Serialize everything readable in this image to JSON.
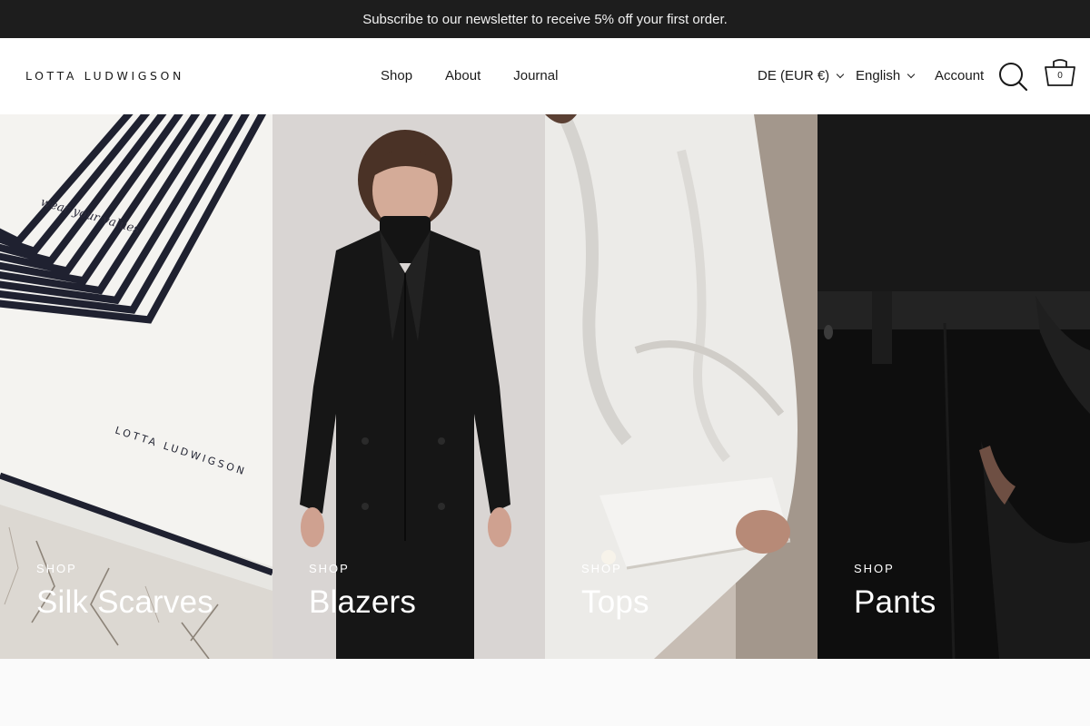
{
  "announcement": "Subscribe to our newsletter to receive 5% off your first order.",
  "brand": "LOTTA LUDWIGSON",
  "nav": [
    "Shop",
    "About",
    "Journal"
  ],
  "utility": {
    "country": "DE (EUR €)",
    "language": "English",
    "account": "Account",
    "cart_count": "0"
  },
  "collections": [
    {
      "kicker": "SHOP",
      "title": "Silk Scarves",
      "scarf_handwriting": "wear your values",
      "scarf_print": "LOTTA LUDWIGSON"
    },
    {
      "kicker": "SHOP",
      "title": "Blazers"
    },
    {
      "kicker": "SHOP",
      "title": "Tops"
    },
    {
      "kicker": "SHOP",
      "title": "Pants"
    }
  ],
  "icons": {
    "search": "search-icon",
    "cart": "cart-icon",
    "dropdown": "chevron-down-icon"
  },
  "colors": {
    "announcement_bg": "#1d1d1d",
    "text": "#1a1a1a",
    "overlay_text": "#ffffff"
  }
}
